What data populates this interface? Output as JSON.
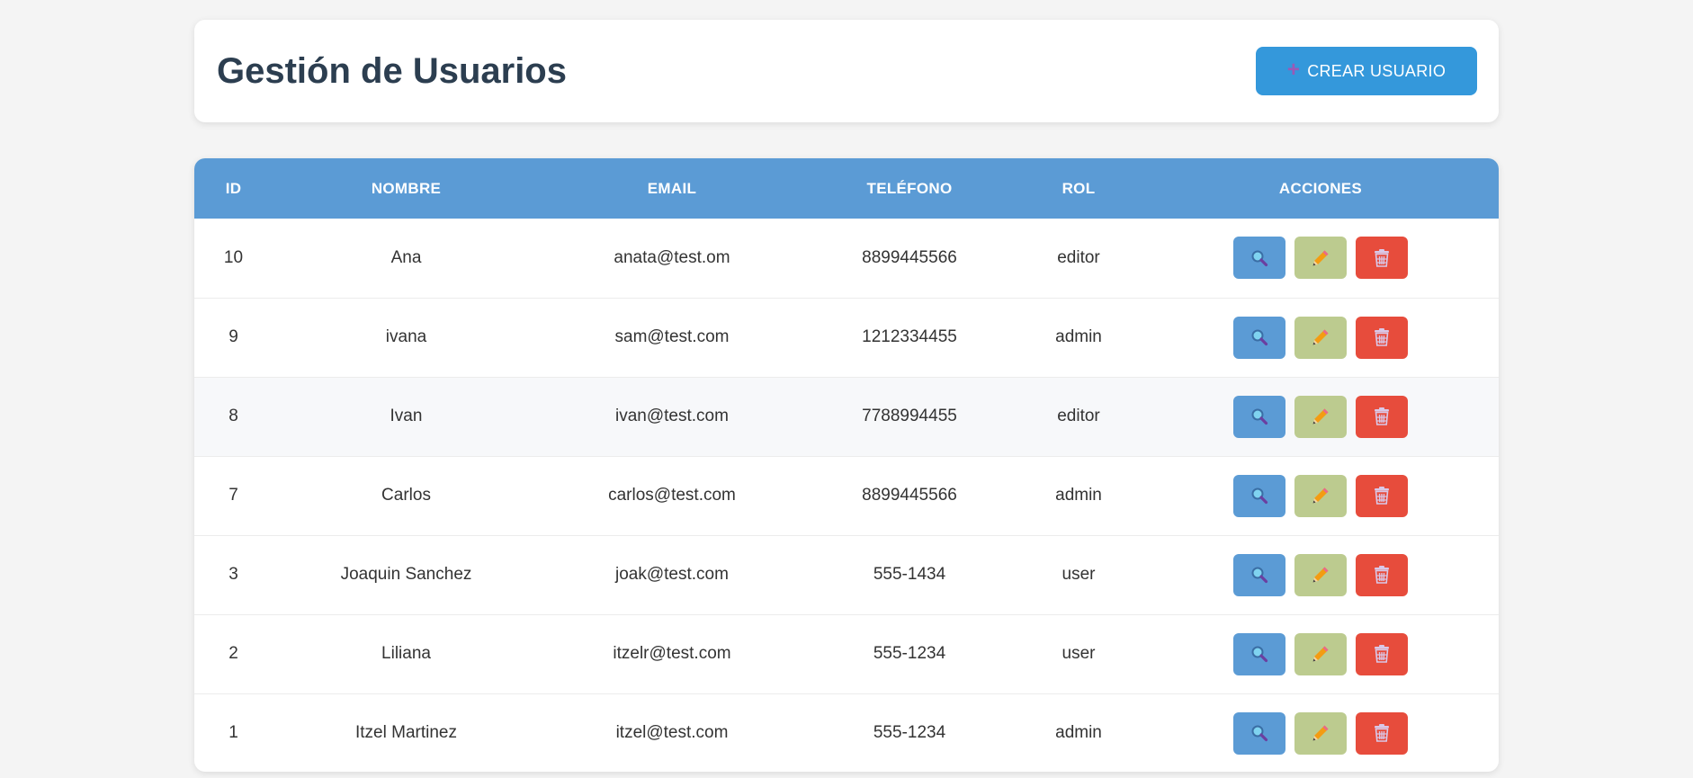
{
  "header": {
    "title": "Gestión de Usuarios",
    "create_button_label": "CREAR USUARIO"
  },
  "table": {
    "columns": [
      "ID",
      "NOMBRE",
      "EMAIL",
      "TELÉFONO",
      "ROL",
      "ACCIONES"
    ],
    "rows": [
      {
        "id": "10",
        "nombre": "Ana",
        "email": "anata@test.om",
        "telefono": "8899445566",
        "rol": "editor"
      },
      {
        "id": "9",
        "nombre": "ivana",
        "email": "sam@test.com",
        "telefono": "1212334455",
        "rol": "admin"
      },
      {
        "id": "8",
        "nombre": "Ivan",
        "email": "ivan@test.com",
        "telefono": "7788994455",
        "rol": "editor"
      },
      {
        "id": "7",
        "nombre": "Carlos",
        "email": "carlos@test.com",
        "telefono": "8899445566",
        "rol": "admin"
      },
      {
        "id": "3",
        "nombre": "Joaquin Sanchez",
        "email": "joak@test.com",
        "telefono": "555-1434",
        "rol": "user"
      },
      {
        "id": "2",
        "nombre": "Liliana",
        "email": "itzelr@test.com",
        "telefono": "555-1234",
        "rol": "user"
      },
      {
        "id": "1",
        "nombre": "Itzel Martinez",
        "email": "itzel@test.com",
        "telefono": "555-1234",
        "rol": "admin"
      }
    ]
  },
  "icons": {
    "create": "plus-icon",
    "view": "magnifier-icon",
    "edit": "pencil-icon",
    "delete": "trash-icon"
  },
  "colors": {
    "primary": "#3498db",
    "table_header": "#5b9bd5",
    "view_button": "#5b9bd5",
    "edit_button": "#bccb8f",
    "delete_button": "#e74c3c",
    "title": "#2c3e50"
  }
}
